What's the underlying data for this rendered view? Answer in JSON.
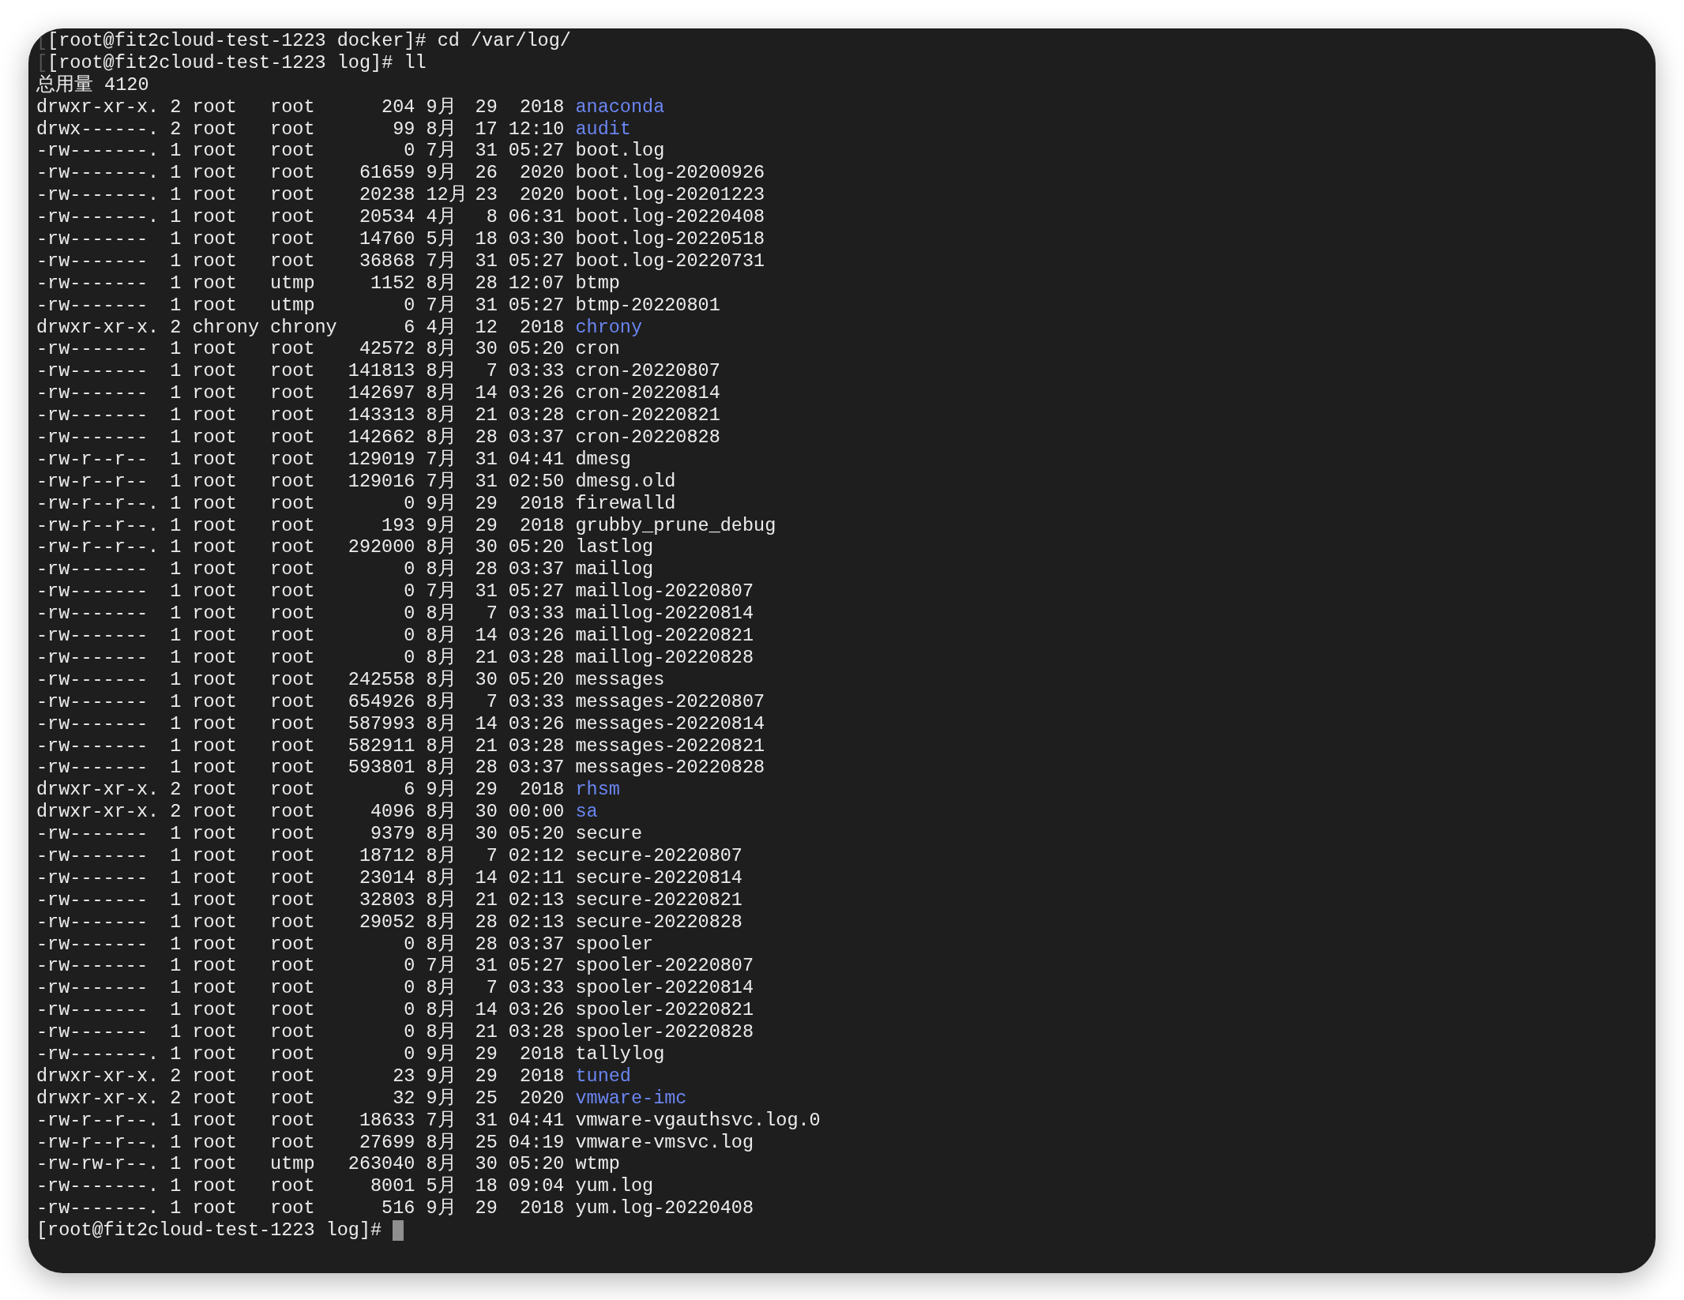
{
  "terminal": {
    "lines": [
      {
        "kind": "prompt",
        "ghost": "[",
        "text": "[root@fit2cloud-test-1223 docker]# cd /var/log/",
        "cursor": false
      },
      {
        "kind": "prompt",
        "ghost": "[",
        "text": "[root@fit2cloud-test-1223 log]# ll",
        "cursor": false
      },
      {
        "kind": "total",
        "text": "总用量 4120"
      },
      {
        "kind": "entry",
        "perms": "drwxr-xr-x.",
        "links": "2",
        "owner": "root",
        "group": "root",
        "size": "204",
        "month": "9月",
        "day": "29",
        "time": "2018",
        "name": "anaconda",
        "directory": true
      },
      {
        "kind": "entry",
        "perms": "drwx------.",
        "links": "2",
        "owner": "root",
        "group": "root",
        "size": "99",
        "month": "8月",
        "day": "17",
        "time": "12:10",
        "name": "audit",
        "directory": true
      },
      {
        "kind": "entry",
        "perms": "-rw-------.",
        "links": "1",
        "owner": "root",
        "group": "root",
        "size": "0",
        "month": "7月",
        "day": "31",
        "time": "05:27",
        "name": "boot.log",
        "directory": false
      },
      {
        "kind": "entry",
        "perms": "-rw-------.",
        "links": "1",
        "owner": "root",
        "group": "root",
        "size": "61659",
        "month": "9月",
        "day": "26",
        "time": "2020",
        "name": "boot.log-20200926",
        "directory": false
      },
      {
        "kind": "entry",
        "perms": "-rw-------.",
        "links": "1",
        "owner": "root",
        "group": "root",
        "size": "20238",
        "month": "12月",
        "day": "23",
        "time": "2020",
        "name": "boot.log-20201223",
        "directory": false
      },
      {
        "kind": "entry",
        "perms": "-rw-------.",
        "links": "1",
        "owner": "root",
        "group": "root",
        "size": "20534",
        "month": "4月",
        "day": "8",
        "time": "06:31",
        "name": "boot.log-20220408",
        "directory": false
      },
      {
        "kind": "entry",
        "perms": "-rw-------",
        "links": "1",
        "owner": "root",
        "group": "root",
        "size": "14760",
        "month": "5月",
        "day": "18",
        "time": "03:30",
        "name": "boot.log-20220518",
        "directory": false
      },
      {
        "kind": "entry",
        "perms": "-rw-------",
        "links": "1",
        "owner": "root",
        "group": "root",
        "size": "36868",
        "month": "7月",
        "day": "31",
        "time": "05:27",
        "name": "boot.log-20220731",
        "directory": false
      },
      {
        "kind": "entry",
        "perms": "-rw-------",
        "links": "1",
        "owner": "root",
        "group": "utmp",
        "size": "1152",
        "month": "8月",
        "day": "28",
        "time": "12:07",
        "name": "btmp",
        "directory": false
      },
      {
        "kind": "entry",
        "perms": "-rw-------",
        "links": "1",
        "owner": "root",
        "group": "utmp",
        "size": "0",
        "month": "7月",
        "day": "31",
        "time": "05:27",
        "name": "btmp-20220801",
        "directory": false
      },
      {
        "kind": "entry",
        "perms": "drwxr-xr-x.",
        "links": "2",
        "owner": "chrony",
        "group": "chrony",
        "size": "6",
        "month": "4月",
        "day": "12",
        "time": "2018",
        "name": "chrony",
        "directory": true
      },
      {
        "kind": "entry",
        "perms": "-rw-------",
        "links": "1",
        "owner": "root",
        "group": "root",
        "size": "42572",
        "month": "8月",
        "day": "30",
        "time": "05:20",
        "name": "cron",
        "directory": false
      },
      {
        "kind": "entry",
        "perms": "-rw-------",
        "links": "1",
        "owner": "root",
        "group": "root",
        "size": "141813",
        "month": "8月",
        "day": "7",
        "time": "03:33",
        "name": "cron-20220807",
        "directory": false
      },
      {
        "kind": "entry",
        "perms": "-rw-------",
        "links": "1",
        "owner": "root",
        "group": "root",
        "size": "142697",
        "month": "8月",
        "day": "14",
        "time": "03:26",
        "name": "cron-20220814",
        "directory": false
      },
      {
        "kind": "entry",
        "perms": "-rw-------",
        "links": "1",
        "owner": "root",
        "group": "root",
        "size": "143313",
        "month": "8月",
        "day": "21",
        "time": "03:28",
        "name": "cron-20220821",
        "directory": false
      },
      {
        "kind": "entry",
        "perms": "-rw-------",
        "links": "1",
        "owner": "root",
        "group": "root",
        "size": "142662",
        "month": "8月",
        "day": "28",
        "time": "03:37",
        "name": "cron-20220828",
        "directory": false
      },
      {
        "kind": "entry",
        "perms": "-rw-r--r--",
        "links": "1",
        "owner": "root",
        "group": "root",
        "size": "129019",
        "month": "7月",
        "day": "31",
        "time": "04:41",
        "name": "dmesg",
        "directory": false
      },
      {
        "kind": "entry",
        "perms": "-rw-r--r--",
        "links": "1",
        "owner": "root",
        "group": "root",
        "size": "129016",
        "month": "7月",
        "day": "31",
        "time": "02:50",
        "name": "dmesg.old",
        "directory": false
      },
      {
        "kind": "entry",
        "perms": "-rw-r--r--.",
        "links": "1",
        "owner": "root",
        "group": "root",
        "size": "0",
        "month": "9月",
        "day": "29",
        "time": "2018",
        "name": "firewalld",
        "directory": false
      },
      {
        "kind": "entry",
        "perms": "-rw-r--r--.",
        "links": "1",
        "owner": "root",
        "group": "root",
        "size": "193",
        "month": "9月",
        "day": "29",
        "time": "2018",
        "name": "grubby_prune_debug",
        "directory": false
      },
      {
        "kind": "entry",
        "perms": "-rw-r--r--.",
        "links": "1",
        "owner": "root",
        "group": "root",
        "size": "292000",
        "month": "8月",
        "day": "30",
        "time": "05:20",
        "name": "lastlog",
        "directory": false
      },
      {
        "kind": "entry",
        "perms": "-rw-------",
        "links": "1",
        "owner": "root",
        "group": "root",
        "size": "0",
        "month": "8月",
        "day": "28",
        "time": "03:37",
        "name": "maillog",
        "directory": false
      },
      {
        "kind": "entry",
        "perms": "-rw-------",
        "links": "1",
        "owner": "root",
        "group": "root",
        "size": "0",
        "month": "7月",
        "day": "31",
        "time": "05:27",
        "name": "maillog-20220807",
        "directory": false
      },
      {
        "kind": "entry",
        "perms": "-rw-------",
        "links": "1",
        "owner": "root",
        "group": "root",
        "size": "0",
        "month": "8月",
        "day": "7",
        "time": "03:33",
        "name": "maillog-20220814",
        "directory": false
      },
      {
        "kind": "entry",
        "perms": "-rw-------",
        "links": "1",
        "owner": "root",
        "group": "root",
        "size": "0",
        "month": "8月",
        "day": "14",
        "time": "03:26",
        "name": "maillog-20220821",
        "directory": false
      },
      {
        "kind": "entry",
        "perms": "-rw-------",
        "links": "1",
        "owner": "root",
        "group": "root",
        "size": "0",
        "month": "8月",
        "day": "21",
        "time": "03:28",
        "name": "maillog-20220828",
        "directory": false
      },
      {
        "kind": "entry",
        "perms": "-rw-------",
        "links": "1",
        "owner": "root",
        "group": "root",
        "size": "242558",
        "month": "8月",
        "day": "30",
        "time": "05:20",
        "name": "messages",
        "directory": false
      },
      {
        "kind": "entry",
        "perms": "-rw-------",
        "links": "1",
        "owner": "root",
        "group": "root",
        "size": "654926",
        "month": "8月",
        "day": "7",
        "time": "03:33",
        "name": "messages-20220807",
        "directory": false
      },
      {
        "kind": "entry",
        "perms": "-rw-------",
        "links": "1",
        "owner": "root",
        "group": "root",
        "size": "587993",
        "month": "8月",
        "day": "14",
        "time": "03:26",
        "name": "messages-20220814",
        "directory": false
      },
      {
        "kind": "entry",
        "perms": "-rw-------",
        "links": "1",
        "owner": "root",
        "group": "root",
        "size": "582911",
        "month": "8月",
        "day": "21",
        "time": "03:28",
        "name": "messages-20220821",
        "directory": false
      },
      {
        "kind": "entry",
        "perms": "-rw-------",
        "links": "1",
        "owner": "root",
        "group": "root",
        "size": "593801",
        "month": "8月",
        "day": "28",
        "time": "03:37",
        "name": "messages-20220828",
        "directory": false
      },
      {
        "kind": "entry",
        "perms": "drwxr-xr-x.",
        "links": "2",
        "owner": "root",
        "group": "root",
        "size": "6",
        "month": "9月",
        "day": "29",
        "time": "2018",
        "name": "rhsm",
        "directory": true
      },
      {
        "kind": "entry",
        "perms": "drwxr-xr-x.",
        "links": "2",
        "owner": "root",
        "group": "root",
        "size": "4096",
        "month": "8月",
        "day": "30",
        "time": "00:00",
        "name": "sa",
        "directory": true
      },
      {
        "kind": "entry",
        "perms": "-rw-------",
        "links": "1",
        "owner": "root",
        "group": "root",
        "size": "9379",
        "month": "8月",
        "day": "30",
        "time": "05:20",
        "name": "secure",
        "directory": false
      },
      {
        "kind": "entry",
        "perms": "-rw-------",
        "links": "1",
        "owner": "root",
        "group": "root",
        "size": "18712",
        "month": "8月",
        "day": "7",
        "time": "02:12",
        "name": "secure-20220807",
        "directory": false
      },
      {
        "kind": "entry",
        "perms": "-rw-------",
        "links": "1",
        "owner": "root",
        "group": "root",
        "size": "23014",
        "month": "8月",
        "day": "14",
        "time": "02:11",
        "name": "secure-20220814",
        "directory": false
      },
      {
        "kind": "entry",
        "perms": "-rw-------",
        "links": "1",
        "owner": "root",
        "group": "root",
        "size": "32803",
        "month": "8月",
        "day": "21",
        "time": "02:13",
        "name": "secure-20220821",
        "directory": false
      },
      {
        "kind": "entry",
        "perms": "-rw-------",
        "links": "1",
        "owner": "root",
        "group": "root",
        "size": "29052",
        "month": "8月",
        "day": "28",
        "time": "02:13",
        "name": "secure-20220828",
        "directory": false
      },
      {
        "kind": "entry",
        "perms": "-rw-------",
        "links": "1",
        "owner": "root",
        "group": "root",
        "size": "0",
        "month": "8月",
        "day": "28",
        "time": "03:37",
        "name": "spooler",
        "directory": false
      },
      {
        "kind": "entry",
        "perms": "-rw-------",
        "links": "1",
        "owner": "root",
        "group": "root",
        "size": "0",
        "month": "7月",
        "day": "31",
        "time": "05:27",
        "name": "spooler-20220807",
        "directory": false
      },
      {
        "kind": "entry",
        "perms": "-rw-------",
        "links": "1",
        "owner": "root",
        "group": "root",
        "size": "0",
        "month": "8月",
        "day": "7",
        "time": "03:33",
        "name": "spooler-20220814",
        "directory": false
      },
      {
        "kind": "entry",
        "perms": "-rw-------",
        "links": "1",
        "owner": "root",
        "group": "root",
        "size": "0",
        "month": "8月",
        "day": "14",
        "time": "03:26",
        "name": "spooler-20220821",
        "directory": false
      },
      {
        "kind": "entry",
        "perms": "-rw-------",
        "links": "1",
        "owner": "root",
        "group": "root",
        "size": "0",
        "month": "8月",
        "day": "21",
        "time": "03:28",
        "name": "spooler-20220828",
        "directory": false
      },
      {
        "kind": "entry",
        "perms": "-rw-------.",
        "links": "1",
        "owner": "root",
        "group": "root",
        "size": "0",
        "month": "9月",
        "day": "29",
        "time": "2018",
        "name": "tallylog",
        "directory": false
      },
      {
        "kind": "entry",
        "perms": "drwxr-xr-x.",
        "links": "2",
        "owner": "root",
        "group": "root",
        "size": "23",
        "month": "9月",
        "day": "29",
        "time": "2018",
        "name": "tuned",
        "directory": true
      },
      {
        "kind": "entry",
        "perms": "drwxr-xr-x.",
        "links": "2",
        "owner": "root",
        "group": "root",
        "size": "32",
        "month": "9月",
        "day": "25",
        "time": "2020",
        "name": "vmware-imc",
        "directory": true
      },
      {
        "kind": "entry",
        "perms": "-rw-r--r--.",
        "links": "1",
        "owner": "root",
        "group": "root",
        "size": "18633",
        "month": "7月",
        "day": "31",
        "time": "04:41",
        "name": "vmware-vgauthsvc.log.0",
        "directory": false
      },
      {
        "kind": "entry",
        "perms": "-rw-r--r--.",
        "links": "1",
        "owner": "root",
        "group": "root",
        "size": "27699",
        "month": "8月",
        "day": "25",
        "time": "04:19",
        "name": "vmware-vmsvc.log",
        "directory": false
      },
      {
        "kind": "entry",
        "perms": "-rw-rw-r--.",
        "links": "1",
        "owner": "root",
        "group": "utmp",
        "size": "263040",
        "month": "8月",
        "day": "30",
        "time": "05:20",
        "name": "wtmp",
        "directory": false
      },
      {
        "kind": "entry",
        "perms": "-rw-------.",
        "links": "1",
        "owner": "root",
        "group": "root",
        "size": "8001",
        "month": "5月",
        "day": "18",
        "time": "09:04",
        "name": "yum.log",
        "directory": false
      },
      {
        "kind": "entry",
        "perms": "-rw-------.",
        "links": "1",
        "owner": "root",
        "group": "root",
        "size": "516",
        "month": "9月",
        "day": "29",
        "time": "2018",
        "name": "yum.log-20220408",
        "directory": false
      },
      {
        "kind": "prompt",
        "text": "[root@fit2cloud-test-1223 log]#",
        "cursor": true
      }
    ]
  }
}
